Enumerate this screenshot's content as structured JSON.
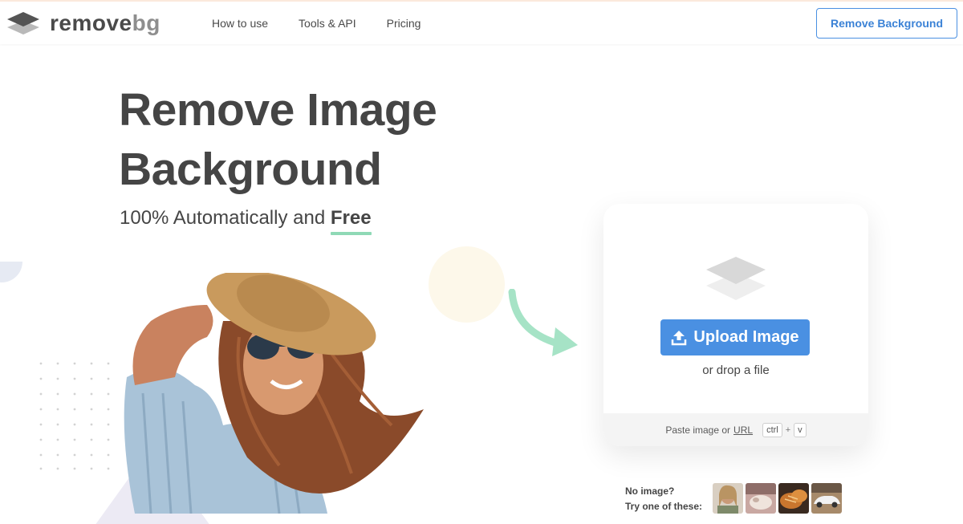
{
  "nav": {
    "logo_main": "remove",
    "logo_accent": "bg",
    "links": [
      "How to use",
      "Tools & API",
      "Pricing"
    ],
    "cta_label": "Remove Background"
  },
  "hero": {
    "title_line1": "Remove Image",
    "title_line2": "Background",
    "subtitle_prefix": "100% Automatically and",
    "subtitle_highlight": "Free",
    "underline_color": "#8fd9b6"
  },
  "upload": {
    "button_label": "Upload Image",
    "drop_text": "or drop a file",
    "paste_prefix": "Paste image or",
    "paste_link": "URL",
    "key_ctrl": "ctrl",
    "key_plus": "+",
    "key_v": "v"
  },
  "samples": {
    "line1": "No image?",
    "line2": "Try one of these:",
    "thumbnails": [
      "woman-portrait-thumbnail",
      "animal-thumbnail",
      "bread-thumbnail",
      "car-thumbnail"
    ]
  },
  "colors": {
    "accent_blue": "#4a90e2",
    "text_dark": "#454545",
    "mint": "#8fd9b6"
  },
  "icons": [
    "layers-logo-icon",
    "upload-icon",
    "layers-icon",
    "arrow-icon"
  ]
}
